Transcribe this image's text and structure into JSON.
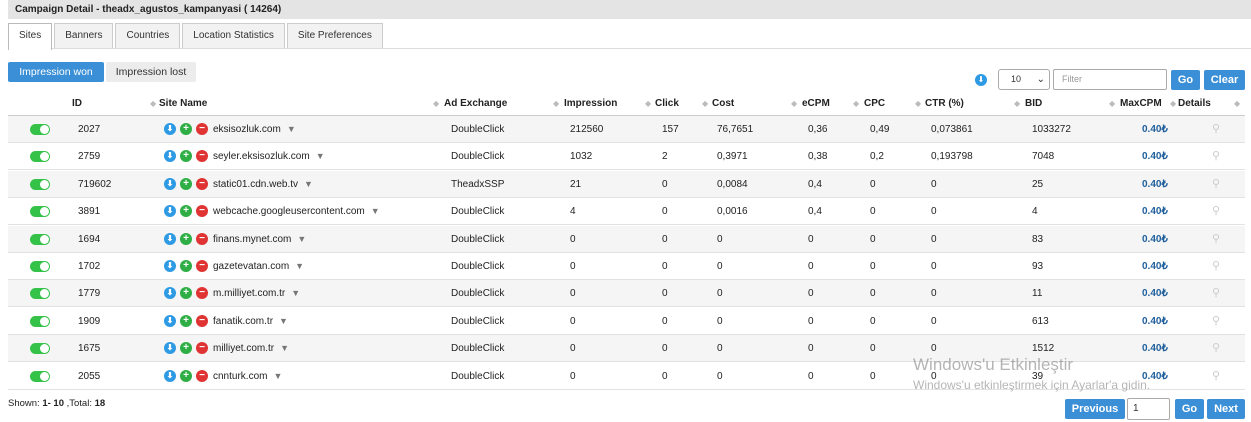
{
  "window": {
    "title": "Campaign Detail - theadx_agustos_kampanyasi ( 14264)"
  },
  "tabs": [
    {
      "label": "Sites",
      "active": true
    },
    {
      "label": "Banners"
    },
    {
      "label": "Countries"
    },
    {
      "label": "Location Statistics"
    },
    {
      "label": "Site Preferences"
    }
  ],
  "toggle_buttons": {
    "won": "Impression won",
    "lost": "Impression lost"
  },
  "controls": {
    "page_size": "10",
    "filter_placeholder": "Filter",
    "go_label": "Go",
    "clear_label": "Clear"
  },
  "columns": [
    "ID",
    "Site Name",
    "Ad Exchange",
    "Impression",
    "Click",
    "Cost",
    "eCPM",
    "CPC",
    "CTR (%)",
    "BID",
    "MaxCPM",
    "Details"
  ],
  "rows": [
    {
      "id": "2027",
      "site": "eksisozluk.com",
      "exchange": "DoubleClick",
      "impression": "212560",
      "click": "157",
      "cost": "76,7651",
      "ecpm": "0,36",
      "cpc": "0,49",
      "ctr": "0,073861",
      "bid": "1033272",
      "maxcpm": "0.40₺"
    },
    {
      "id": "2759",
      "site": "seyler.eksisozluk.com",
      "exchange": "DoubleClick",
      "impression": "1032",
      "click": "2",
      "cost": "0,3971",
      "ecpm": "0,38",
      "cpc": "0,2",
      "ctr": "0,193798",
      "bid": "7048",
      "maxcpm": "0.40₺"
    },
    {
      "id": "719602",
      "site": "static01.cdn.web.tv",
      "exchange": "TheadxSSP",
      "impression": "21",
      "click": "0",
      "cost": "0,0084",
      "ecpm": "0,4",
      "cpc": "0",
      "ctr": "0",
      "bid": "25",
      "maxcpm": "0.40₺"
    },
    {
      "id": "3891",
      "site": "webcache.googleusercontent.com",
      "exchange": "DoubleClick",
      "impression": "4",
      "click": "0",
      "cost": "0,0016",
      "ecpm": "0,4",
      "cpc": "0",
      "ctr": "0",
      "bid": "4",
      "maxcpm": "0.40₺"
    },
    {
      "id": "1694",
      "site": "finans.mynet.com",
      "exchange": "DoubleClick",
      "impression": "0",
      "click": "0",
      "cost": "0",
      "ecpm": "0",
      "cpc": "0",
      "ctr": "0",
      "bid": "83",
      "maxcpm": "0.40₺"
    },
    {
      "id": "1702",
      "site": "gazetevatan.com",
      "exchange": "DoubleClick",
      "impression": "0",
      "click": "0",
      "cost": "0",
      "ecpm": "0",
      "cpc": "0",
      "ctr": "0",
      "bid": "93",
      "maxcpm": "0.40₺"
    },
    {
      "id": "1779",
      "site": "m.milliyet.com.tr",
      "exchange": "DoubleClick",
      "impression": "0",
      "click": "0",
      "cost": "0",
      "ecpm": "0",
      "cpc": "0",
      "ctr": "0",
      "bid": "11",
      "maxcpm": "0.40₺"
    },
    {
      "id": "1909",
      "site": "fanatik.com.tr",
      "exchange": "DoubleClick",
      "impression": "0",
      "click": "0",
      "cost": "0",
      "ecpm": "0",
      "cpc": "0",
      "ctr": "0",
      "bid": "613",
      "maxcpm": "0.40₺"
    },
    {
      "id": "1675",
      "site": "milliyet.com.tr",
      "exchange": "DoubleClick",
      "impression": "0",
      "click": "0",
      "cost": "0",
      "ecpm": "0",
      "cpc": "0",
      "ctr": "0",
      "bid": "1512",
      "maxcpm": "0.40₺"
    },
    {
      "id": "2055",
      "site": "cnnturk.com",
      "exchange": "DoubleClick",
      "impression": "0",
      "click": "0",
      "cost": "0",
      "ecpm": "0",
      "cpc": "0",
      "ctr": "0",
      "bid": "39",
      "maxcpm": "0.40₺"
    }
  ],
  "footer": {
    "shown_prefix": "Shown: ",
    "shown_range": "1- 10",
    "total_prefix": " ,Total: ",
    "total": "18",
    "prev_label": "Previous",
    "page": "1",
    "go_label": "Go",
    "next_label": "Next"
  },
  "watermark": {
    "line1": "Windows'u Etkinleştir",
    "line2": "Windows'u etkinleştirmek için Ayarlar'a gidin."
  },
  "colors": {
    "primary": "#3a8fd6",
    "toggle_on": "#34c249",
    "add": "#2fae45",
    "remove": "#e03434",
    "maxcpm": "#1f5f9c"
  }
}
